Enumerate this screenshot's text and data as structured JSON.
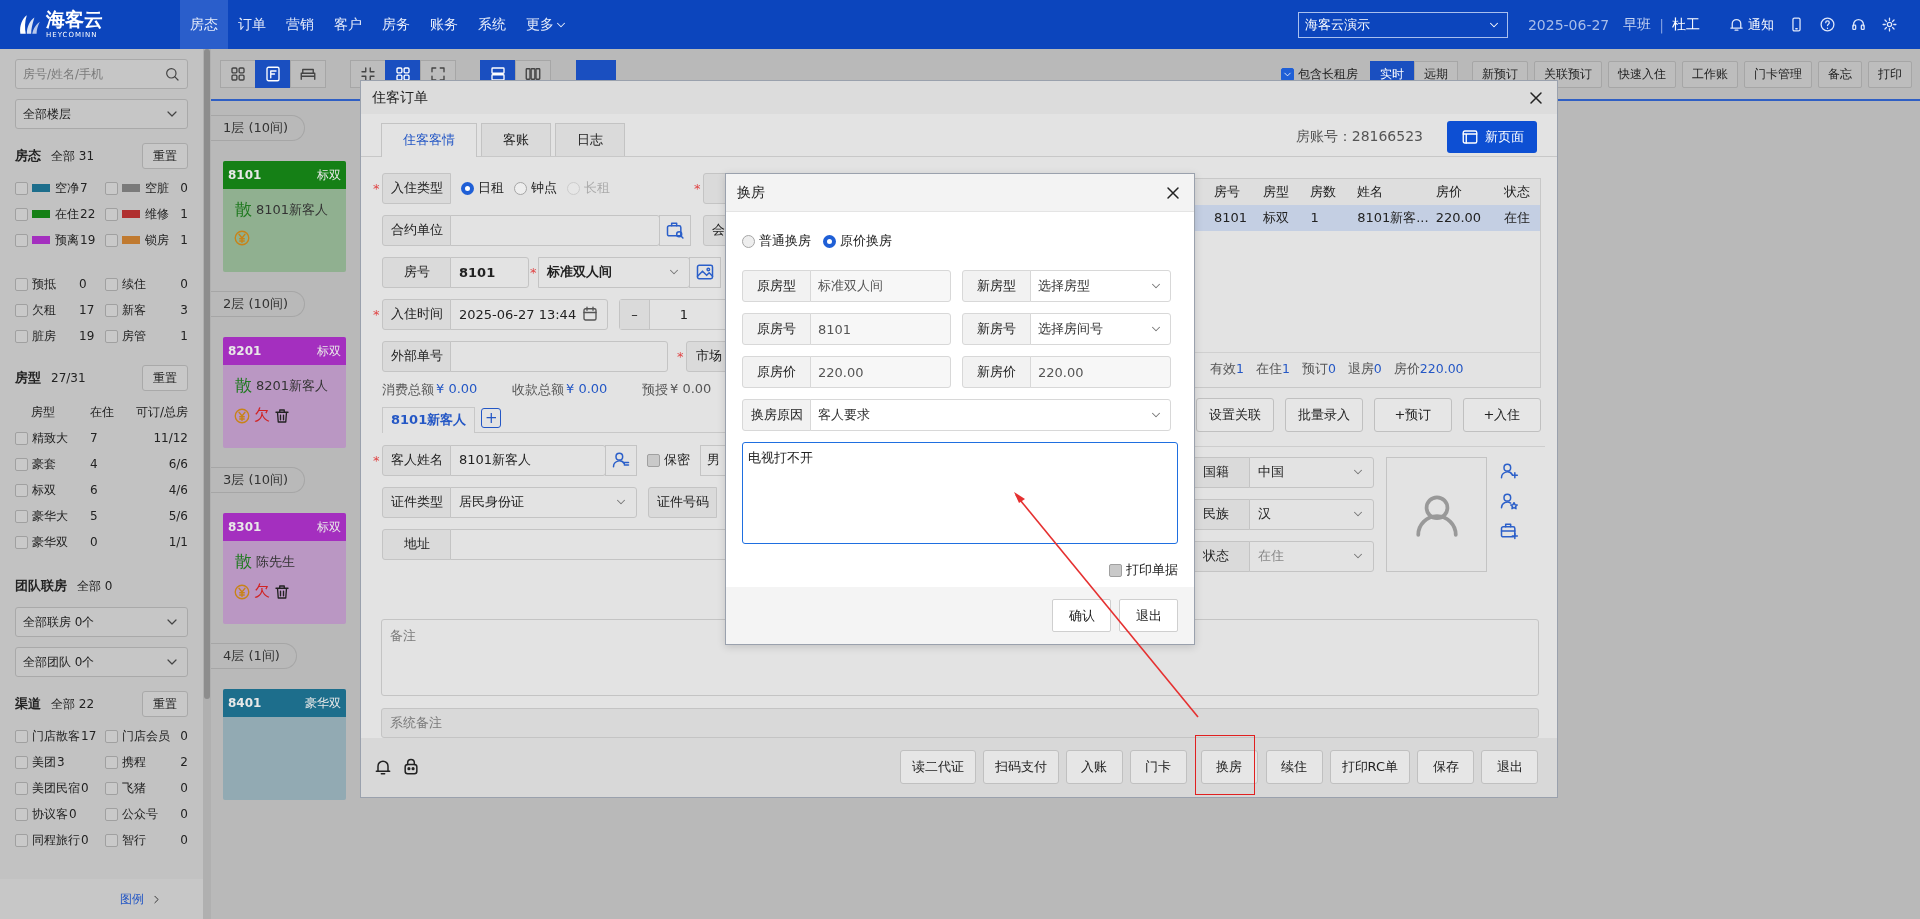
{
  "top_bar": {
    "logo": {
      "name": "海客云",
      "sub": "HEYCOMINN"
    },
    "nav": [
      {
        "label": "房态",
        "selected": true
      },
      {
        "label": "订单",
        "selected": false
      },
      {
        "label": "营销",
        "selected": false
      },
      {
        "label": "客户",
        "selected": false
      },
      {
        "label": "房务",
        "selected": false
      },
      {
        "label": "账务",
        "selected": false
      },
      {
        "label": "系统",
        "selected": false
      },
      {
        "label": "更多",
        "selected": false,
        "dropdown": true
      }
    ],
    "hotel": "海客云演示",
    "date": "2025-06-27",
    "shift": "早班",
    "separator": "|",
    "user": "杜工",
    "notice": "通知"
  },
  "sidebar": {
    "search": {
      "placeholder": "房号/姓名/手机"
    },
    "floor_select": "全部楼层",
    "room_status": {
      "title": "房态",
      "total": "全部 31",
      "reset": "重置",
      "items": [
        {
          "label": "空净",
          "count": "7",
          "color": "#1d6e8c",
          "checked": false
        },
        {
          "label": "空脏",
          "count": "0",
          "color": "#7a7a7a",
          "checked": false
        },
        {
          "label": "在住",
          "count": "22",
          "color": "#158016",
          "checked": false
        },
        {
          "label": "维修",
          "count": "1",
          "color": "#b03030",
          "checked": false
        },
        {
          "label": "预离",
          "count": "19",
          "color": "#a42fbf",
          "checked": false
        },
        {
          "label": "锁房",
          "count": "1",
          "color": "#c07a30",
          "checked": false
        }
      ]
    },
    "flags": [
      {
        "label": "预抵",
        "count": "0",
        "checked": false
      },
      {
        "label": "续住",
        "count": "0",
        "checked": false
      },
      {
        "label": "欠租",
        "count": "17",
        "checked": false
      },
      {
        "label": "新客",
        "count": "3",
        "checked": false
      },
      {
        "label": "脏房",
        "count": "19",
        "checked": false
      },
      {
        "label": "房管",
        "count": "1",
        "checked": false
      }
    ],
    "room_types": {
      "title": "房型",
      "total": "27/31",
      "reset": "重置",
      "columns": [
        "房型",
        "在住",
        "可订/总房"
      ],
      "rows": [
        {
          "name": "精致大",
          "in_house": "7",
          "available": "11/12",
          "checked": false
        },
        {
          "name": "豪套",
          "in_house": "4",
          "available": "6/6",
          "checked": false
        },
        {
          "name": "标双",
          "in_house": "6",
          "available": "4/6",
          "checked": false
        },
        {
          "name": "豪华大",
          "in_house": "5",
          "available": "5/6",
          "checked": false
        },
        {
          "name": "豪华双",
          "in_house": "0",
          "available": "1/1",
          "checked": false
        }
      ]
    },
    "team": {
      "title": "团队联房",
      "total": "全部 0",
      "selects": [
        "全部联房 0个",
        "全部团队 0个"
      ]
    },
    "channels": {
      "title": "渠道",
      "total": "全部 22",
      "reset": "重置",
      "items": [
        {
          "label": "门店散客",
          "count": "17",
          "checked": false
        },
        {
          "label": "门店会员",
          "count": "0",
          "checked": false
        },
        {
          "label": "美团",
          "count": "3",
          "checked": false
        },
        {
          "label": "携程",
          "count": "2",
          "checked": false
        },
        {
          "label": "美团民宿",
          "count": "0",
          "checked": false
        },
        {
          "label": "飞猪",
          "count": "0",
          "checked": false
        },
        {
          "label": "协议客",
          "count": "0",
          "checked": false
        },
        {
          "label": "公众号",
          "count": "0",
          "checked": false
        },
        {
          "label": "同程旅行",
          "count": "0",
          "checked": false
        },
        {
          "label": "智行",
          "count": "0",
          "checked": false
        }
      ]
    },
    "legend_link": "图例"
  },
  "toolbar": {
    "views": [
      {
        "kind": "grid",
        "selected": false
      },
      {
        "kind": "floor",
        "selected": true
      },
      {
        "kind": "bed",
        "selected": false
      }
    ],
    "zoom": [
      {
        "kind": "collapse",
        "selected": false
      },
      {
        "kind": "grid",
        "selected": true
      },
      {
        "kind": "expand",
        "selected": false
      }
    ],
    "layouts": [
      {
        "kind": "rows",
        "selected": true
      },
      {
        "kind": "columns",
        "selected": false
      }
    ],
    "long_rent": {
      "label": "包含长租房",
      "checked": true
    },
    "modes": [
      {
        "label": "实时",
        "selected": true
      },
      {
        "label": "远期",
        "selected": false
      }
    ],
    "actions": [
      "新预订",
      "关联预订",
      "快速入住",
      "工作账",
      "门卡管理",
      "备忘",
      "打印"
    ]
  },
  "floors": [
    {
      "label": "1层 (10间)",
      "rooms": [
        {
          "number": "8101",
          "type": "标双",
          "color": "#158016",
          "source": "散",
          "guest": "8101新客人",
          "marks": [
            {
              "kind": "yen"
            }
          ]
        }
      ]
    },
    {
      "label": "2层 (10间)",
      "rooms": [
        {
          "number": "8201",
          "type": "标双",
          "color": "#a42fbf",
          "source": "散",
          "guest": "8201新客人",
          "marks": [
            {
              "kind": "yen"
            },
            {
              "kind": "owe",
              "text": "欠"
            },
            {
              "kind": "trash"
            }
          ]
        }
      ]
    },
    {
      "label": "3层 (10间)",
      "rooms": [
        {
          "number": "8301",
          "type": "标双",
          "color": "#a42fbf",
          "source": "散",
          "guest": "陈先生",
          "marks": [
            {
              "kind": "yen"
            },
            {
              "kind": "owe",
              "text": "欠"
            },
            {
              "kind": "trash"
            }
          ]
        }
      ]
    },
    {
      "label": "4层 (1间)",
      "rooms": [
        {
          "number": "8401",
          "type": "豪华双",
          "color": "#1d6e8c"
        }
      ]
    }
  ],
  "order_dialog": {
    "title": "住客订单",
    "tabs": [
      {
        "label": "住客客情",
        "selected": true
      },
      {
        "label": "客账",
        "selected": false
      },
      {
        "label": "日志",
        "selected": false
      }
    ],
    "account": "房账号：28166523",
    "new_page": "新页面",
    "required_mark": "*",
    "status_peek": {
      "required": true
    },
    "stay_type": {
      "label": "入住类型",
      "required": true,
      "options": [
        {
          "label": "日租",
          "selected": true,
          "disabled": false
        },
        {
          "label": "钟点",
          "selected": false,
          "disabled": false
        },
        {
          "label": "长租",
          "selected": false,
          "disabled": true
        }
      ]
    },
    "contract": {
      "label": "合约单位"
    },
    "member_peek": "会",
    "room": {
      "label": "房号",
      "value": "8101"
    },
    "room_type": {
      "value": "标准双人间",
      "required": true
    },
    "checkin": {
      "label": "入住时间",
      "value": "2025-06-27 13:44",
      "required": true
    },
    "nights": {
      "minus": "–",
      "value": "1"
    },
    "external": {
      "label": "外部单号"
    },
    "market_peek": {
      "label": "市场",
      "required": true
    },
    "totals": [
      {
        "label": "消费总额",
        "value": "¥ 0.00",
        "highlight": true
      },
      {
        "label": "收款总额",
        "value": "¥ 0.00",
        "highlight": true
      },
      {
        "label": "预授",
        "value": "¥ 0.00",
        "highlight": false
      }
    ],
    "guest_tabs": [
      {
        "label": "8101新客人",
        "selected": true
      }
    ],
    "add_guest": "+",
    "guest_name": {
      "label": "客人姓名",
      "value": "8101新客人",
      "required": true
    },
    "secret": {
      "label": "保密",
      "checked": false
    },
    "gender_peek": "男",
    "id_type": {
      "label": "证件类型",
      "value": "居民身份证"
    },
    "id_number_label": "证件号码",
    "address": {
      "label": "地址"
    },
    "remark": {
      "placeholder": "备注"
    },
    "system_remark": {
      "placeholder": "系统备注"
    },
    "rooms_table": {
      "columns": [
        "房号",
        "房型",
        "房数",
        "姓名",
        "房价",
        "状态"
      ],
      "rows": [
        {
          "cells": [
            "8101",
            "标双",
            "1",
            "8101新客...",
            "220.00",
            "在住"
          ],
          "selected": true
        }
      ],
      "summary": [
        {
          "label": "有效",
          "value": "1"
        },
        {
          "label": "在住",
          "value": "1"
        },
        {
          "label": "预订",
          "value": "0"
        },
        {
          "label": "退房",
          "value": "0"
        },
        {
          "label": "房价",
          "value": "220.00"
        }
      ]
    },
    "room_buttons": [
      "设置关联",
      "批量录入",
      "+预订",
      "+入住"
    ],
    "side_fields": [
      {
        "label": "国籍",
        "value": "中国",
        "disabled": false
      },
      {
        "label": "民族",
        "value": "汉",
        "disabled": false
      },
      {
        "label": "状态",
        "value": "在住",
        "disabled": true
      }
    ],
    "footer_buttons": [
      {
        "label": "读二代证",
        "highlighted": false
      },
      {
        "label": "扫码支付",
        "highlighted": false
      },
      {
        "label": "入账",
        "highlighted": false
      },
      {
        "label": "门卡",
        "highlighted": false
      },
      {
        "label": "换房",
        "highlighted": true
      },
      {
        "label": "续住",
        "highlighted": false
      },
      {
        "label": "打印RC单",
        "highlighted": false
      },
      {
        "label": "保存",
        "highlighted": false
      },
      {
        "label": "退出",
        "highlighted": false
      }
    ]
  },
  "swap_dialog": {
    "title": "换房",
    "modes": [
      {
        "label": "普通换房",
        "selected": false
      },
      {
        "label": "原价换房",
        "selected": true
      }
    ],
    "fields": [
      {
        "label": "原房型",
        "value": "标准双人间",
        "kind": "text"
      },
      {
        "label": "新房型",
        "value": "选择房型",
        "kind": "select"
      },
      {
        "label": "原房号",
        "value": "8101",
        "kind": "text"
      },
      {
        "label": "新房号",
        "value": "选择房间号",
        "kind": "select"
      },
      {
        "label": "原房价",
        "value": "220.00",
        "kind": "text"
      },
      {
        "label": "新房价",
        "value": "220.00",
        "kind": "text"
      }
    ],
    "reason": {
      "label": "换房原因",
      "value": "客人要求"
    },
    "note": "电视打不开",
    "print": {
      "label": "打印单据",
      "checked": false
    },
    "buttons": [
      "确认",
      "退出"
    ]
  }
}
